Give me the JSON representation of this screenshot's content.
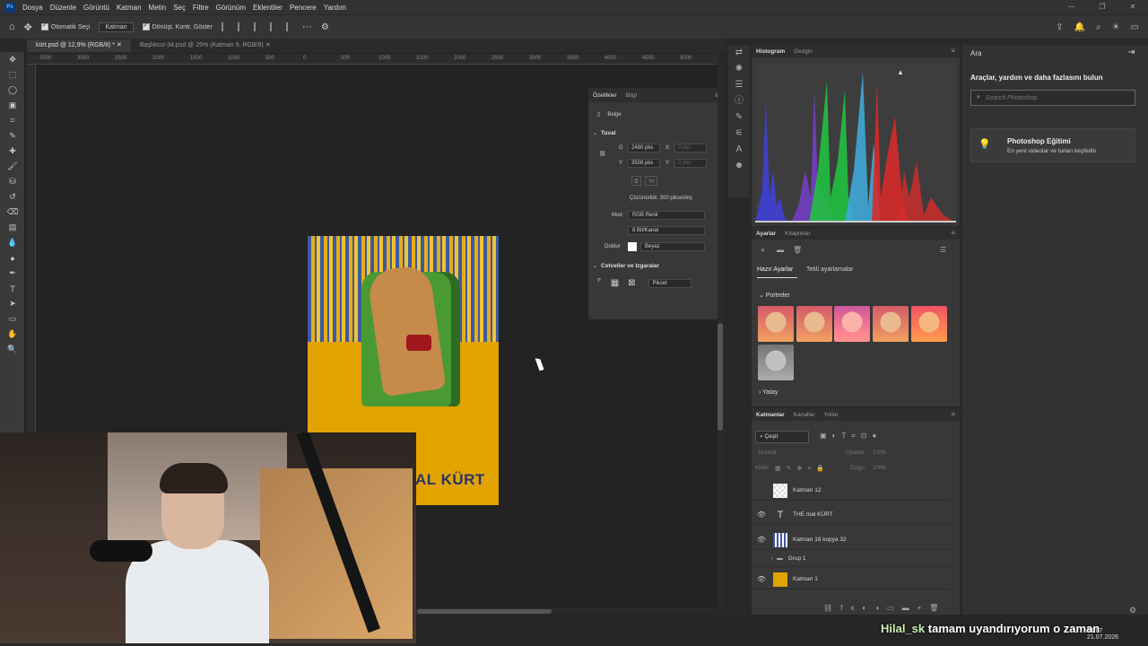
{
  "menubar": {
    "items": [
      "Dosya",
      "Düzenle",
      "Görüntü",
      "Katman",
      "Metin",
      "Seç",
      "Filtre",
      "Görünüm",
      "Eklentiler",
      "Pencere",
      "Yardım"
    ]
  },
  "options": {
    "auto_select": "Otomatik Seçi",
    "auto_select_target": "Katman",
    "show_transform": "Dönüşt. Kontr. Göster"
  },
  "tabs": [
    {
      "label": "kürt.psd @ 12,9% (RGB/8) *"
    },
    {
      "label": "Başlıksız-34.psd @ 25% (Katman 9, RGB/8)"
    }
  ],
  "ruler": [
    "3500",
    "3000",
    "2500",
    "2000",
    "1500",
    "1000",
    "500",
    "0",
    "500",
    "1000",
    "1500",
    "2000",
    "2500",
    "3000",
    "3500",
    "4000",
    "4500",
    "5000"
  ],
  "artwork": {
    "title": "AL KÜRT"
  },
  "properties": {
    "tabs": [
      "Özellikler",
      "Bilgi"
    ],
    "doc_label": "Belge",
    "canvas_section": "Tuval",
    "width_label": "G",
    "width": "2480 pks",
    "x_label": "X",
    "x_placeholder": "0 pks",
    "height_label": "Y",
    "height": "3508 pks",
    "y_label": "Y",
    "y_placeholder": "0 pks",
    "resolution": "Çözünürlük: 300 piksel/inç",
    "mode_label": "Mod",
    "mode": "RGB Renk",
    "bit": "8 Bit/Kanal",
    "fill_label": "Doldur",
    "fill": "Beyaz",
    "rulers_section": "Cetveller ve Izgaralar",
    "unit": "Piksel"
  },
  "histogram": {
    "tabs": [
      "Histogram",
      "Gezgin"
    ]
  },
  "adjustments": {
    "tabs": [
      "Ayarlar",
      "Kitaplıklar"
    ],
    "subtabs": [
      "Hazır Ayarlar",
      "Tekli ayarlamalar"
    ],
    "group_portraits": "Portreler",
    "group_landscape": "Yatay"
  },
  "layers": {
    "tabs": [
      "Katmanlar",
      "Kanallar",
      "Yollar"
    ],
    "filter": "Çeşit",
    "blend": "Normal",
    "opacity_label": "Opaklık:",
    "opacity": "100%",
    "lock_label": "Kilitle:",
    "fill_label": "Dolgu:",
    "fill": "100%",
    "items": [
      {
        "name": "Katman 12"
      },
      {
        "name": "THE mal KÜRT"
      },
      {
        "name": "Katman 18 kopya 32"
      },
      {
        "name": "Grup 1"
      },
      {
        "name": "Katman 1"
      }
    ]
  },
  "search": {
    "title": "Ara",
    "heading": "Araçlar, yardım ve daha fazlasını bulun",
    "placeholder": "Search Photoshop",
    "learn_title": "Photoshop Eğitimi",
    "learn_sub": "En yeni videolar ve turları keşfedin"
  },
  "chat": {
    "user": "Hilal_sk",
    "message": "tamam uyandırıyorum o zaman"
  },
  "clock": {
    "time": "21:07",
    "date": "21.07.2026"
  }
}
